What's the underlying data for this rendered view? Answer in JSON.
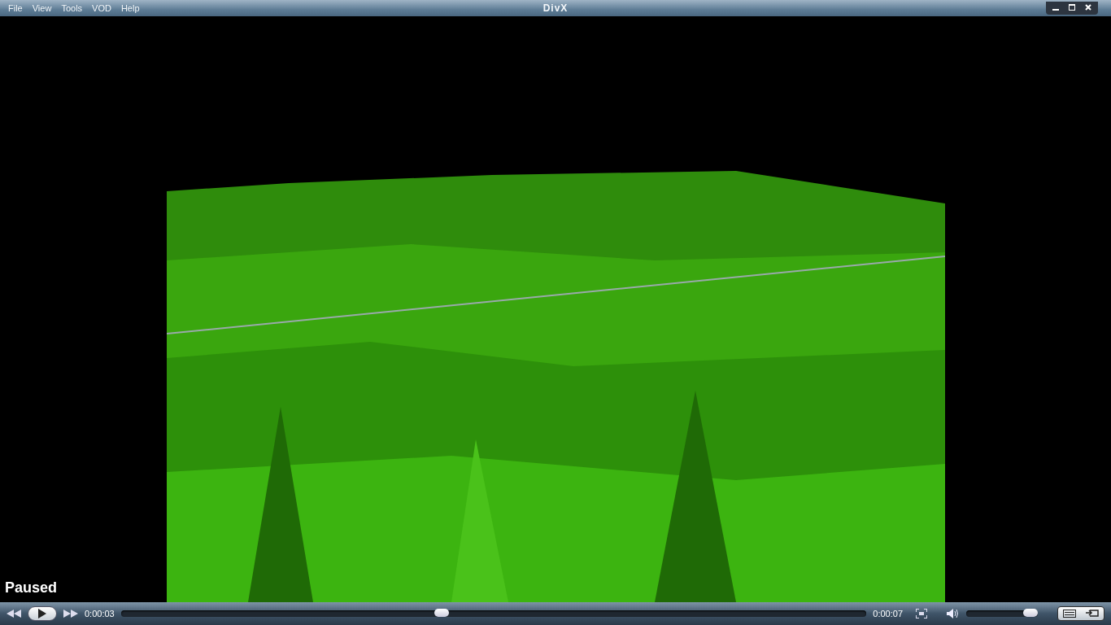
{
  "window": {
    "title": "DivX"
  },
  "menu": [
    "File",
    "View",
    "Tools",
    "VOD",
    "Help"
  ],
  "video": {
    "kind": "picture",
    "status": "Paused"
  },
  "controls": {
    "elapsed": "0:00:03",
    "duration": "0:00:07",
    "paused": true,
    "seek": {
      "level": 0.43
    },
    "volume": {
      "level": 0.9
    }
  }
}
